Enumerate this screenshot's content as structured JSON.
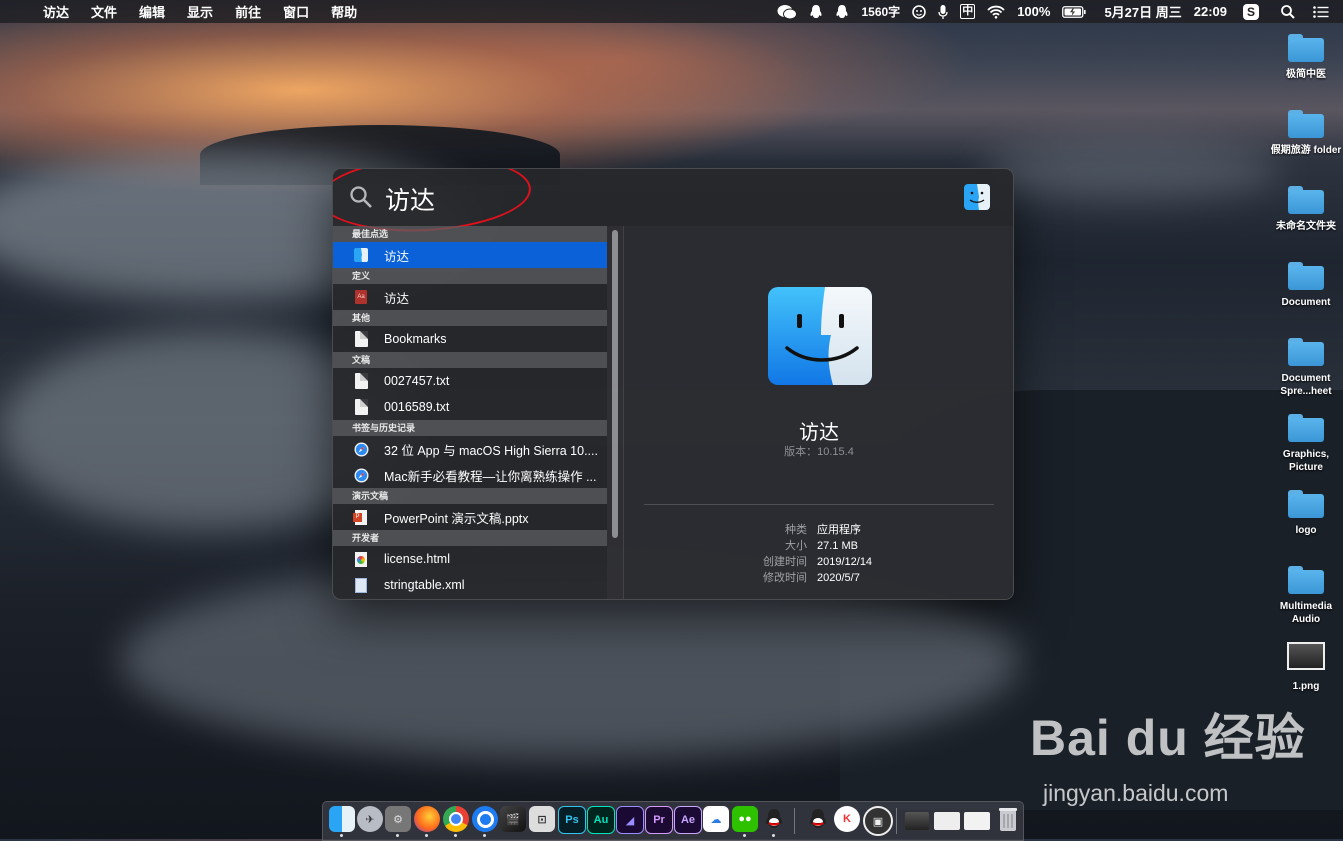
{
  "menubar": {
    "apple_glyph": "",
    "items": [
      "访达",
      "文件",
      "编辑",
      "显示",
      "前往",
      "窗口",
      "帮助"
    ],
    "status": {
      "word_count": "1560字",
      "input_method": "中",
      "battery": "100%",
      "date": "5月27日 周三",
      "time": "22:09"
    }
  },
  "desktop": {
    "icons": [
      {
        "label": "极简中医"
      },
      {
        "label": "假期旅游 folder"
      },
      {
        "label": "未命名文件夹"
      },
      {
        "label": "Document"
      },
      {
        "label": "Document Spre...heet"
      },
      {
        "label": "Graphics, Picture"
      },
      {
        "label": "logo"
      },
      {
        "label": "Multimedia Audio"
      },
      {
        "label": "1.png"
      }
    ]
  },
  "spotlight": {
    "query": "访达",
    "sections": [
      {
        "title": "最佳点选",
        "items": [
          {
            "label": "访达",
            "icon": "finder-icon",
            "selected": true
          }
        ]
      },
      {
        "title": "定义",
        "items": [
          {
            "label": "访达",
            "icon": "dictionary-icon"
          }
        ]
      },
      {
        "title": "其他",
        "items": [
          {
            "label": "Bookmarks",
            "icon": "document-icon"
          }
        ]
      },
      {
        "title": "文稿",
        "items": [
          {
            "label": "0027457.txt",
            "icon": "document-icon"
          },
          {
            "label": "0016589.txt",
            "icon": "document-icon"
          }
        ]
      },
      {
        "title": "书签与历史记录",
        "items": [
          {
            "label": "32 位 App 与 macOS High Sierra 10....",
            "icon": "safari-icon"
          },
          {
            "label": "Mac新手必看教程—让你离熟练操作 ...",
            "icon": "safari-icon"
          }
        ]
      },
      {
        "title": "演示文稿",
        "items": [
          {
            "label": "PowerPoint 演示文稿.pptx",
            "icon": "powerpoint-icon"
          }
        ]
      },
      {
        "title": "开发者",
        "items": [
          {
            "label": "license.html",
            "icon": "html-file-icon"
          },
          {
            "label": "stringtable.xml",
            "icon": "xml-file-icon"
          }
        ]
      }
    ],
    "detail": {
      "name": "访达",
      "version": "版本：10.15.4",
      "meta": [
        {
          "key": "种类",
          "value": "应用程序"
        },
        {
          "key": "大小",
          "value": "27.1 MB"
        },
        {
          "key": "创建时间",
          "value": "2019/12/14"
        },
        {
          "key": "修改时间",
          "value": "2020/5/7"
        }
      ]
    }
  },
  "dock": {
    "apps": [
      "finder-icon",
      "launchpad-icon",
      "system-preferences-icon",
      "firefox-icon",
      "chrome-icon",
      "quicktime-icon",
      "final-cut-icon",
      "screenshot-icon",
      "photoshop-icon",
      "audition-icon",
      "media-encoder-icon",
      "premiere-icon",
      "after-effects-icon",
      "baidu-netdisk-icon",
      "wechat-icon",
      "qq-icon",
      "qq2-icon",
      "kugou-icon",
      "screen-capture-icon",
      "window-1-icon",
      "window-2-icon",
      "window-3-icon",
      "trash-icon"
    ],
    "labels": {
      "ps": "Ps",
      "au": "Au",
      "pr": "Pr",
      "ae": "Ae"
    }
  },
  "watermark": {
    "brand": "Bai du 经验",
    "url": "jingyan.baidu.com"
  },
  "colors": {
    "selection": "#0a61d8",
    "annotation_circle": "#e0111b"
  }
}
